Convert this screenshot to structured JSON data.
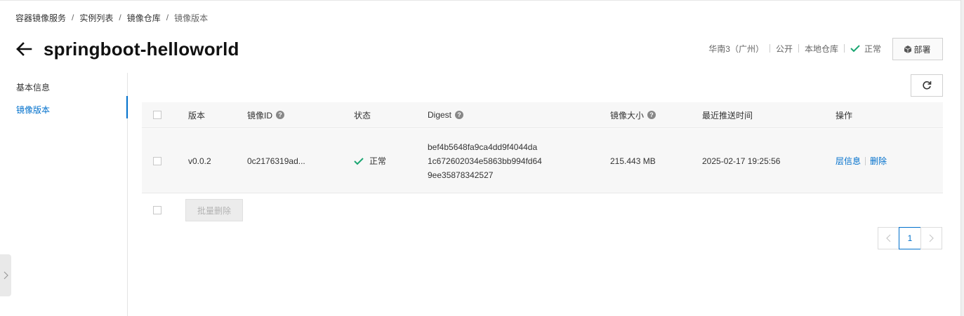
{
  "breadcrumb": [
    "容器镜像服务",
    "实例列表",
    "镜像仓库",
    "镜像版本"
  ],
  "breadcrumb_sep": "/",
  "title": "springboot-helloworld",
  "meta": {
    "region": "华南3（广州）",
    "visibility": "公开",
    "repo_type": "本地仓库",
    "status": "正常"
  },
  "actions": {
    "deploy": "部署"
  },
  "sidebar": {
    "items": [
      {
        "label": "基本信息",
        "active": false
      },
      {
        "label": "镜像版本",
        "active": true
      }
    ]
  },
  "table": {
    "headers": {
      "version": "版本",
      "image_id": "镜像ID",
      "status": "状态",
      "digest": "Digest",
      "size": "镜像大小",
      "pushed": "最近推送时间",
      "ops": "操作"
    },
    "rows": [
      {
        "version": "v0.0.2",
        "image_id": "0c2176319ad...",
        "status": "正常",
        "digest": [
          "bef4b5648fa9ca4dd9f4044da",
          "1c672602034e5863bb994fd64",
          "9ee35878342527"
        ],
        "size": "215.443 MB",
        "pushed": "2025-02-17 19:25:56",
        "op_layers": "层信息",
        "op_delete": "删除"
      }
    ],
    "batch_delete": "批量删除"
  },
  "pagination": {
    "current": "1"
  },
  "colors": {
    "accent": "#0070cc",
    "ok": "#1ba672"
  }
}
